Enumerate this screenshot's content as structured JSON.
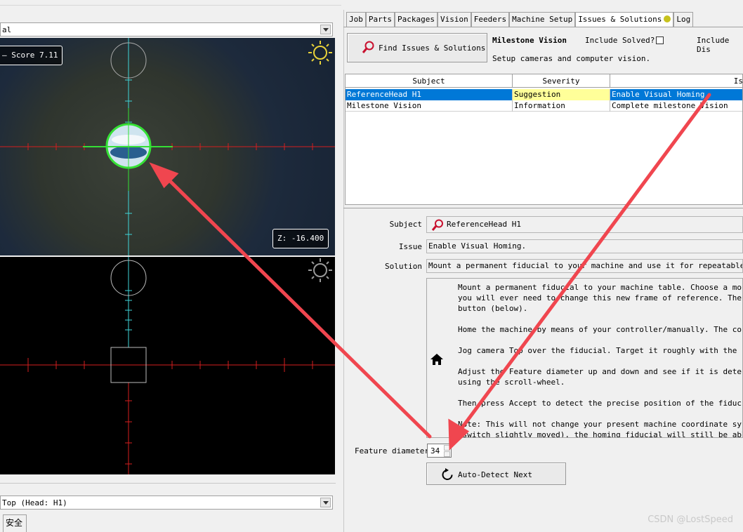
{
  "left": {
    "camera_select_value": "al",
    "top_view": {
      "score_label": "– Score 7.11",
      "z_label": "Z: -16.400"
    },
    "camera_combo_value": "Top (Head: H1)",
    "bottom_tab_label": "安全"
  },
  "tabs": [
    "Job",
    "Parts",
    "Packages",
    "Vision",
    "Feeders",
    "Machine Setup",
    "Issues & Solutions",
    "Log"
  ],
  "issues": {
    "find_button_label": "Find Issues & Solutions",
    "milestone_title": "Milestone Vision",
    "milestone_desc": "Setup cameras and computer vision.",
    "include_solved_label": "Include Solved?",
    "include_dismissed_label": "Include Dis",
    "table": {
      "columns": [
        "Subject",
        "Severity",
        "Is"
      ],
      "rows": [
        {
          "subject": "ReferenceHead H1",
          "severity": "Suggestion",
          "issue": "Enable Visual Homing."
        },
        {
          "subject": "Milestone Vision",
          "severity": "Information",
          "issue": "Complete milestone Vision"
        }
      ]
    },
    "detail": {
      "subject_label": "Subject",
      "subject_value": "ReferenceHead H1",
      "issue_label": "Issue",
      "issue_value": "Enable Visual Homing.",
      "solution_label": "Solution",
      "solution_value": "Mount a permanent fiducial to your machine and use it for repeatable precis",
      "instructions": [
        "Mount a permanent fiducial to your machine table. Choose a mounting",
        "you will ever need to change this new frame of reference. The fiduci",
        "button (below).",
        "",
        "Home the machine by means of your controller/manually. The controlle",
        "",
        "Jog camera Top over the fiducial. Target it roughly with the cross-h",
        "",
        "Adjust the Feature diameter up and down and see if it is detected",
        "using the scroll-wheel.",
        "",
        "Then press Accept to detect the precise position of the fiducial and",
        "",
        "Note: This will not change your present machine coordinate system, b",
        "-switch slightly moved), the homing fiducial will still be able t"
      ],
      "feature_diameter_label": "Feature diameter",
      "feature_diameter_value": "34",
      "auto_detect_label": "Auto-Detect Next"
    }
  },
  "watermark": "CSDN @LostSpeed",
  "colors": {
    "selection": "#0078d7",
    "suggestion_bg": "#ffff99",
    "crosshair_red": "#d41e1e",
    "crosshair_cyan": "#3fd5d8",
    "detect_green": "#35e035",
    "annotation_arrow": "#f0464f"
  }
}
